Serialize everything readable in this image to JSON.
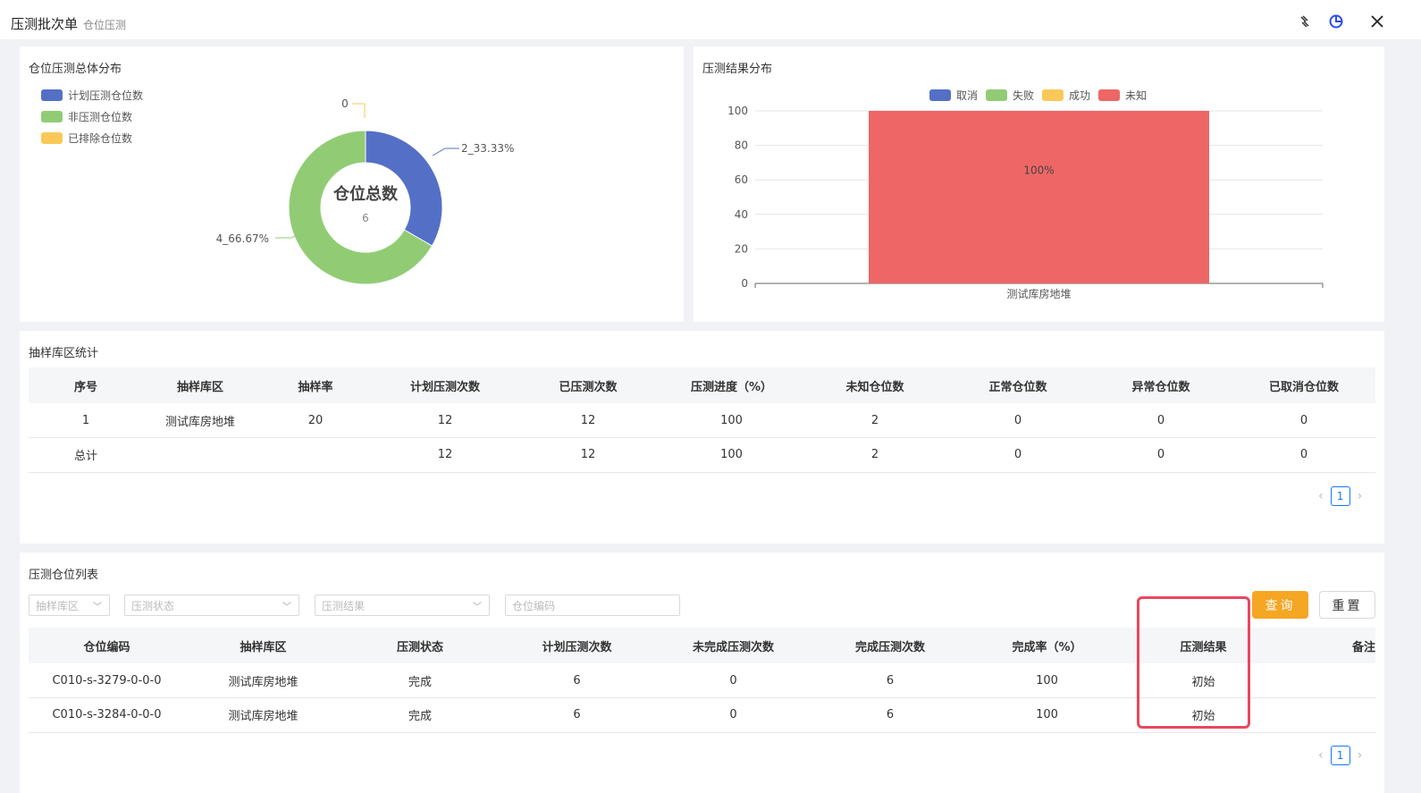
{
  "header": {
    "title": "压测批次单",
    "subtitle": "仓位压测",
    "icons": [
      "link-icon",
      "pie-chart-icon",
      "close-icon"
    ]
  },
  "donut_panel": {
    "title": "仓位压测总体分布",
    "legend": [
      {
        "label": "计划压测仓位数",
        "color": "#5470c6"
      },
      {
        "label": "非压测仓位数",
        "color": "#91cc75"
      },
      {
        "label": "已排除仓位数",
        "color": "#fac858"
      }
    ],
    "center_label": "仓位总数",
    "center_value": "6",
    "slice_labels": {
      "planned": "2_33.33%",
      "non": "4_66.67%",
      "excluded": "0"
    }
  },
  "bar_panel": {
    "title": "压测结果分布",
    "legend": [
      {
        "label": "取消",
        "color": "#5470c6"
      },
      {
        "label": "失败",
        "color": "#91cc75"
      },
      {
        "label": "成功",
        "color": "#fac858"
      },
      {
        "label": "未知",
        "color": "#ee6666"
      }
    ]
  },
  "chart_data": [
    {
      "type": "pie",
      "title": "仓位压测总体分布",
      "categories": [
        "计划压测仓位数",
        "非压测仓位数",
        "已排除仓位数"
      ],
      "values": [
        2,
        4,
        0
      ],
      "center_label": "仓位总数",
      "center_value": 6
    },
    {
      "type": "bar",
      "title": "压测结果分布",
      "categories": [
        "测试库房地堆"
      ],
      "series": [
        {
          "name": "未知",
          "values": [
            100
          ]
        }
      ],
      "data_labels": [
        "100%"
      ],
      "ylim": [
        0,
        100
      ],
      "yticks": [
        "100",
        "80",
        "60",
        "40",
        "20",
        "0"
      ],
      "legend": "top"
    }
  ],
  "sample_panel": {
    "title": "抽样库区统计",
    "columns": [
      "序号",
      "抽样库区",
      "抽样率",
      "计划压测次数",
      "已压测次数",
      "压测进度（%）",
      "未知仓位数",
      "正常仓位数",
      "异常仓位数",
      "已取消仓位数"
    ],
    "rows": [
      [
        "1",
        "测试库房地堆",
        "20",
        "12",
        "12",
        "100",
        "2",
        "0",
        "0",
        "0"
      ],
      [
        "总计",
        "",
        "",
        "12",
        "12",
        "100",
        "2",
        "0",
        "0",
        "0"
      ]
    ],
    "page": "1"
  },
  "list_panel": {
    "title": "压测仓位列表",
    "filters": {
      "zone": "抽样库区",
      "status": "压测状态",
      "result": "压测结果",
      "code": "仓位编码"
    },
    "query_label": "查询",
    "reset_label": "重置",
    "columns": [
      "仓位编码",
      "抽样库区",
      "压测状态",
      "计划压测次数",
      "未完成压测次数",
      "完成压测次数",
      "完成率（%）",
      "压测结果",
      "备注"
    ],
    "rows": [
      [
        "C010-s-3279-0-0-0",
        "测试库房地堆",
        "完成",
        "6",
        "0",
        "6",
        "100",
        "初始",
        ""
      ],
      [
        "C010-s-3284-0-0-0",
        "测试库房地堆",
        "完成",
        "6",
        "0",
        "6",
        "100",
        "初始",
        ""
      ]
    ],
    "page": "1"
  },
  "colors": {
    "accent": "#f5a623",
    "primary": "#1677ff",
    "highlight": "#e8475f"
  }
}
